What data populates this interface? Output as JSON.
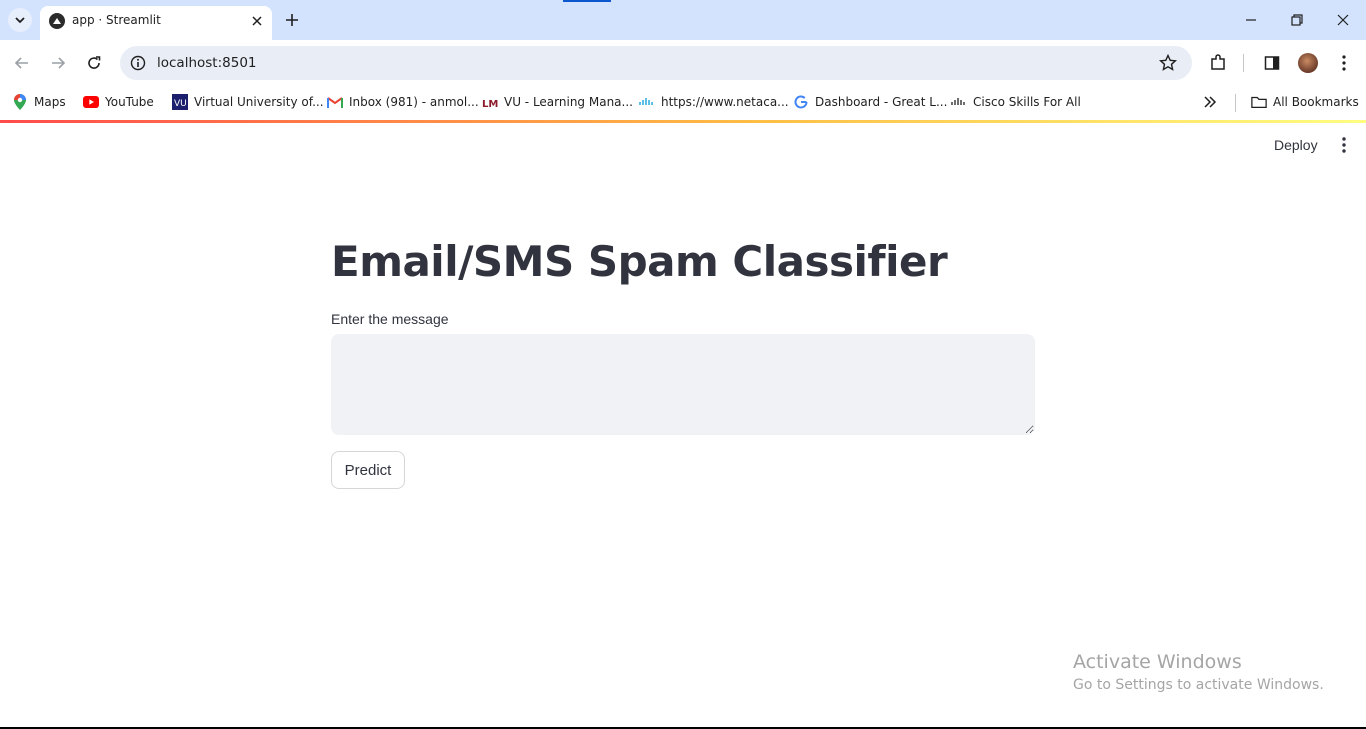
{
  "browser": {
    "tab": {
      "title": "app · Streamlit"
    },
    "address": {
      "url": "localhost:8501"
    },
    "bookmarks": [
      {
        "label": "Maps",
        "icon": "maps-pin-icon"
      },
      {
        "label": "YouTube",
        "icon": "youtube-icon"
      },
      {
        "label": "Virtual University of...",
        "icon": "vu-logo-icon"
      },
      {
        "label": "Inbox (981) - anmol...",
        "icon": "gmail-icon"
      },
      {
        "label": "VU - Learning Mana...",
        "icon": "lms-icon"
      },
      {
        "label": "https://www.netaca...",
        "icon": "cisco-icon"
      },
      {
        "label": "Dashboard - Great L...",
        "icon": "google-g-icon"
      },
      {
        "label": "Cisco Skills For All",
        "icon": "cisco-icon"
      }
    ],
    "all_bookmarks_label": "All Bookmarks"
  },
  "app": {
    "header": {
      "deploy_label": "Deploy"
    },
    "title": "Email/SMS Spam Classifier",
    "input": {
      "label": "Enter the message",
      "value": ""
    },
    "predict_label": "Predict"
  },
  "os": {
    "watermark_title": "Activate Windows",
    "watermark_subtitle": "Go to Settings to activate Windows."
  },
  "colors": {
    "tabstrip": "#d3e3fd",
    "omnibox": "#e9eef6",
    "text": "#31333f",
    "textarea_bg": "#f0f2f6",
    "accent_red": "#ff4b4b"
  }
}
